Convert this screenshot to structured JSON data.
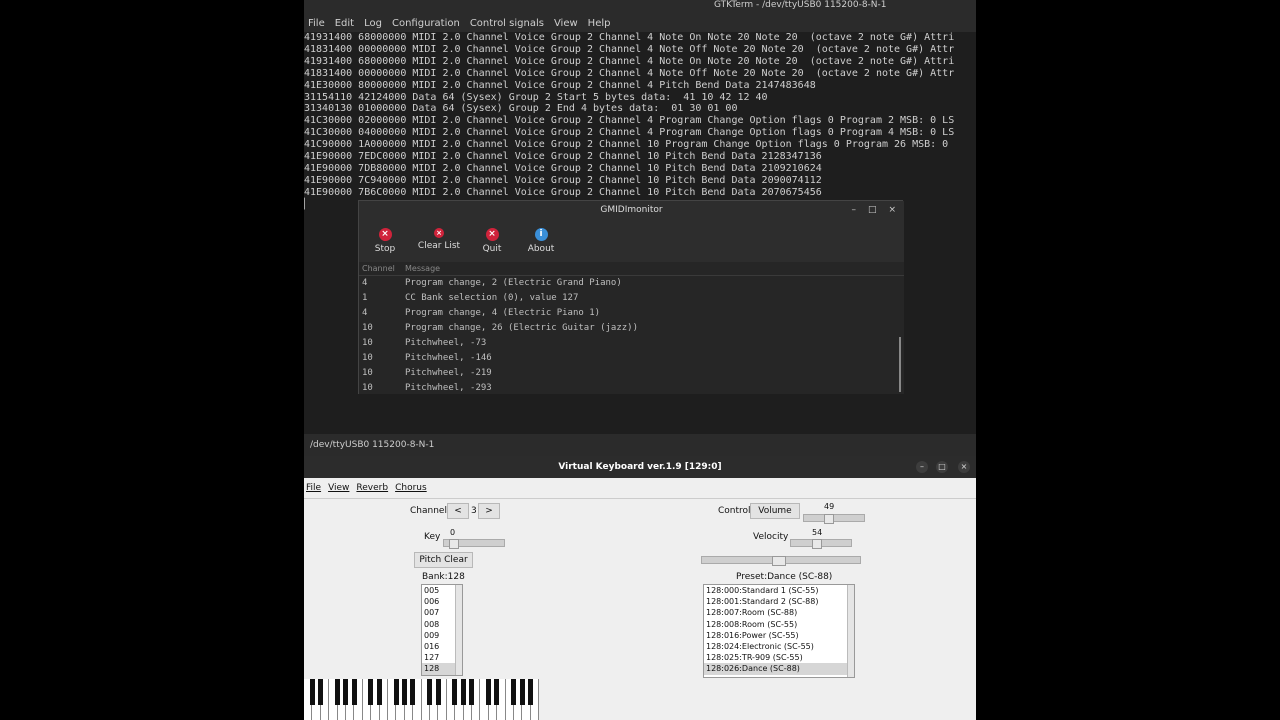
{
  "gtkterm": {
    "title": "GTKTerm - /dev/ttyUSB0  115200-8-N-1",
    "menu": [
      "File",
      "Edit",
      "Log",
      "Configuration",
      "Control signals",
      "View",
      "Help"
    ],
    "lines": [
      "41931400 68000000 MIDI 2.0 Channel Voice Group 2 Channel 4 Note On Note 20 Note 20  (octave 2 note G#) Attri",
      "41831400 00000000 MIDI 2.0 Channel Voice Group 2 Channel 4 Note Off Note 20 Note 20  (octave 2 note G#) Attr",
      "41931400 68000000 MIDI 2.0 Channel Voice Group 2 Channel 4 Note On Note 20 Note 20  (octave 2 note G#) Attri",
      "41831400 00000000 MIDI 2.0 Channel Voice Group 2 Channel 4 Note Off Note 20 Note 20  (octave 2 note G#) Attr",
      "41E30000 80000000 MIDI 2.0 Channel Voice Group 2 Channel 4 Pitch Bend Data 2147483648",
      "31154110 42124000 Data 64 (Sysex) Group 2 Start 5 bytes data:  41 10 42 12 40",
      "31340130 01000000 Data 64 (Sysex) Group 2 End 4 bytes data:  01 30 01 00",
      "41C30000 02000000 MIDI 2.0 Channel Voice Group 2 Channel 4 Program Change Option flags 0 Program 2 MSB: 0 LS",
      "41C30000 04000000 MIDI 2.0 Channel Voice Group 2 Channel 4 Program Change Option flags 0 Program 4 MSB: 0 LS",
      "41C90000 1A000000 MIDI 2.0 Channel Voice Group 2 Channel 10 Program Change Option flags 0 Program 26 MSB: 0",
      "41E90000 7EDC0000 MIDI 2.0 Channel Voice Group 2 Channel 10 Pitch Bend Data 2128347136",
      "41E90000 7DB80000 MIDI 2.0 Channel Voice Group 2 Channel 10 Pitch Bend Data 2109210624",
      "41E90000 7C940000 MIDI 2.0 Channel Voice Group 2 Channel 10 Pitch Bend Data 2090074112",
      "41E90000 7B6C0000 MIDI 2.0 Channel Voice Group 2 Channel 10 Pitch Bend Data 2070675456"
    ],
    "status": "/dev/ttyUSB0  115200-8-N-1"
  },
  "gmidi": {
    "title": "GMIDImonitor",
    "toolbar": {
      "stop": "Stop",
      "clear": "Clear List",
      "quit": "Quit",
      "about": "About"
    },
    "headers": {
      "channel": "Channel",
      "message": "Message"
    },
    "rows": [
      {
        "ch": "4",
        "msg": "Program change, 2 (Electric Grand Piano)"
      },
      {
        "ch": "1",
        "msg": "CC Bank selection (0), value 127"
      },
      {
        "ch": "4",
        "msg": "Program change, 4 (Electric Piano 1)"
      },
      {
        "ch": "10",
        "msg": "Program change, 26 (Electric Guitar (jazz))"
      },
      {
        "ch": "10",
        "msg": "Pitchwheel, -73"
      },
      {
        "ch": "10",
        "msg": "Pitchwheel, -146"
      },
      {
        "ch": "10",
        "msg": "Pitchwheel, -219"
      },
      {
        "ch": "10",
        "msg": "Pitchwheel, -293"
      }
    ]
  },
  "vkbd": {
    "title": "Virtual Keyboard ver.1.9 [129:0]",
    "menu": [
      "File",
      "View",
      "Reverb",
      "Chorus"
    ],
    "channel_label": "Channel",
    "channel_prev": "<",
    "channel_value": "3",
    "channel_next": ">",
    "key_label": "Key",
    "key_value": "0",
    "pitch_clear": "Pitch Clear",
    "bank_label": "Bank:128",
    "banks": [
      "005",
      "006",
      "007",
      "008",
      "009",
      "016",
      "127",
      "128"
    ],
    "control_label": "Control",
    "control_button": "Volume",
    "volume_value": "49",
    "velocity_label": "Velocity",
    "velocity_value": "54",
    "preset_label": "Preset:Dance (SC-88)",
    "presets": [
      "128:000:Standard 1 (SC-55)",
      "128:001:Standard 2 (SC-88)",
      "128:007:Room (SC-88)",
      "128:008:Room (SC-55)",
      "128:016:Power (SC-55)",
      "128:024:Electronic (SC-55)",
      "128:025:TR-909 (SC-55)",
      "128:026:Dance (SC-88)"
    ]
  }
}
